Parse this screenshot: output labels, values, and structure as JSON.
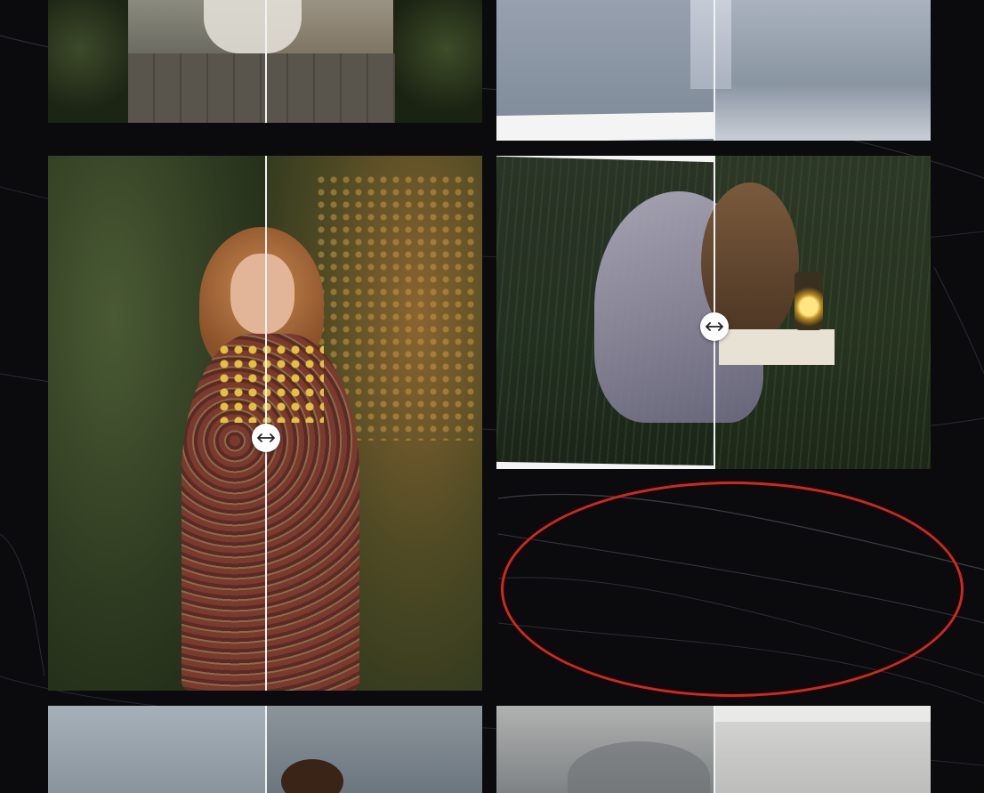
{
  "page": {
    "background": "#0b0b0e"
  },
  "gallery": {
    "tiles": [
      {
        "id": "girl-on-path",
        "before": "#6f6a5e",
        "after": "#7d7364",
        "divider_fraction": 0.5
      },
      {
        "id": "girl-in-water",
        "before": "#8d98a6",
        "after": "#a3adb8",
        "divider_fraction": 0.5
      },
      {
        "id": "girl-with-berries",
        "before": "#3a4228",
        "after": "#5a4a26",
        "divider_fraction": 0.5
      },
      {
        "id": "girl-with-lantern",
        "before": "#273124",
        "after": "#2f3a24",
        "divider_fraction": 0.5
      },
      {
        "id": "girl-windy-sky",
        "before": "#8e98a0",
        "after": "#6f7a82",
        "divider_fraction": 0.5
      },
      {
        "id": "foggy-landscape",
        "before": "#8a8e90",
        "after": "#b8b8b6",
        "divider_fraction": 0.5
      }
    ]
  },
  "colors": {
    "divider": "#f2f2f2",
    "handle": "#ffffff",
    "highlight": "#d4261c"
  },
  "icons": {
    "handle": "arrows-left-right-icon"
  }
}
